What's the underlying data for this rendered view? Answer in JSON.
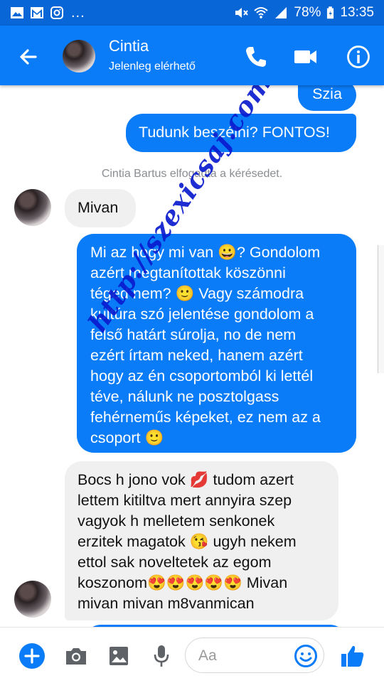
{
  "status_bar": {
    "battery": "78%",
    "time": "13:35",
    "more": "..."
  },
  "header": {
    "contact_name": "Cintia",
    "contact_status": "Jelenleg elérhető"
  },
  "messages": [
    {
      "direction": "outgoing",
      "text": "Szia"
    },
    {
      "direction": "outgoing",
      "text": "Tudunk beszélni? FONTOS!"
    },
    {
      "direction": "system",
      "text": "Cintia Bartus elfogadta a kérésedet."
    },
    {
      "direction": "incoming",
      "text": "Mivan"
    },
    {
      "direction": "outgoing",
      "lines": [
        "Mi az hogy mi van 😀? Gondolom",
        "azért megtanítottak köszönni",
        "téged nem? 🙂 Vagy számodra",
        "kultúra szó jelentése gondolom a",
        "felső határt súrolja, no de nem",
        "ezért  írtam neked, hanem azért",
        "hogy az én csoportomból ki lettél",
        "téve, nálunk ne posztolgass",
        "fehérneműs képeket, ez nem az a",
        "csoport 🙂"
      ]
    },
    {
      "direction": "incoming",
      "lines": [
        "Bocs h jono vok 💋 tudom azert",
        "lettem kitiltva mert annyira szep",
        "vagyok h melletem senkonek",
        "erzitek magatok 😘 ugyh nekem",
        "ettol sak noveltetek az egom",
        "koszonom😍😍😍😍😍 Mivan",
        "mivan mivan m8vanmican"
      ]
    }
  ],
  "watermark": "http://szexicsaj.com",
  "composer": {
    "placeholder": "Aa"
  },
  "colors": {
    "brand_blue": "#0a7cf7",
    "status_bar": "#0866d6",
    "incoming_bubble": "#f0f0f0",
    "watermark": "#0a1ccf"
  },
  "icons": [
    "back-arrow-icon",
    "phone-icon",
    "video-camera-icon",
    "info-icon",
    "plus-icon",
    "camera-icon",
    "gallery-icon",
    "microphone-icon",
    "emoji-icon",
    "thumbs-up-icon"
  ]
}
